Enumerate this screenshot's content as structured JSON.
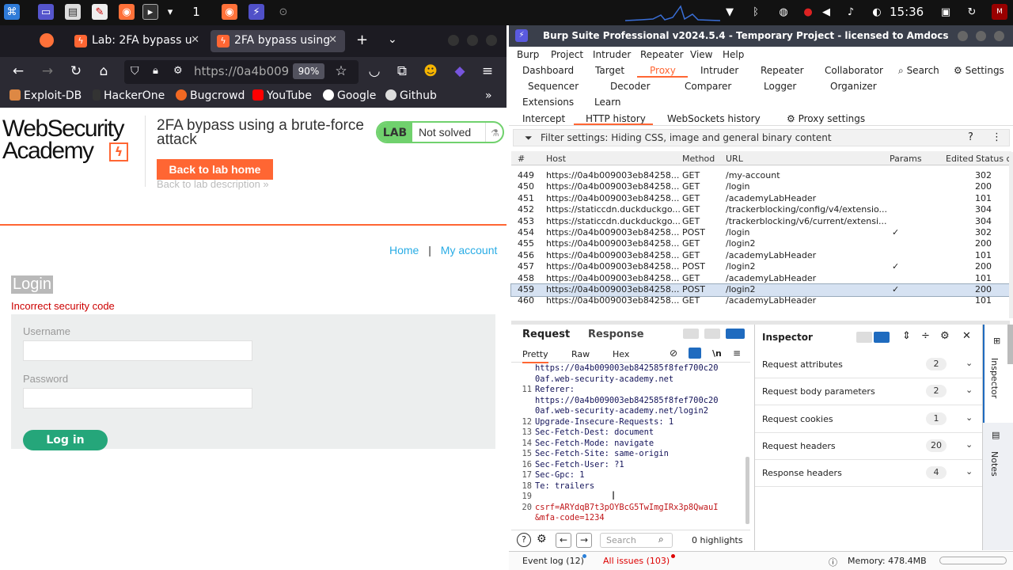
{
  "taskbar": {
    "workspace": "1",
    "clock": "15:36"
  },
  "firefox": {
    "tabs": [
      {
        "label": "Lab: 2FA bypass u"
      },
      {
        "label": "2FA bypass using"
      }
    ],
    "url": "https://0a4b009",
    "zoom": "90%",
    "bookmarks": [
      "Exploit-DB",
      "HackerOne",
      "Bugcrowd",
      "YouTube",
      "Google",
      "Github"
    ]
  },
  "page": {
    "logo_line1": "WebSecurity",
    "logo_line2": "Academy",
    "lab_title": "2FA bypass using a brute-force attack",
    "back_home": "Back to lab home",
    "back_desc": "Back to lab description",
    "badge_lab": "LAB",
    "badge_status": "Not solved",
    "nav_home": "Home",
    "nav_sep": "|",
    "nav_account": "My account",
    "login_heading": "Login",
    "error": "Incorrect security code",
    "username_label": "Username",
    "password_label": "Password",
    "login_button": "Log in"
  },
  "burp": {
    "title": "Burp Suite Professional v2024.5.4 - Temporary Project - licensed to Amdocs",
    "menu": [
      "Burp",
      "Project",
      "Intruder",
      "Repeater",
      "View",
      "Help"
    ],
    "tools_row1": [
      "Dashboard",
      "Target",
      "Proxy",
      "Intruder",
      "Repeater",
      "Collaborator"
    ],
    "tools_row2": [
      "Sequencer",
      "Decoder",
      "Comparer",
      "Logger",
      "Organizer"
    ],
    "tools_row3": [
      "Extensions",
      "Learn"
    ],
    "search": "Search",
    "settings": "Settings",
    "subtabs": [
      "Intercept",
      "HTTP history",
      "WebSockets history"
    ],
    "proxy_settings": "Proxy settings",
    "filter": "Filter settings: Hiding CSS, image and general binary content",
    "columns": [
      "#",
      "Host",
      "Method",
      "URL",
      "Params",
      "Edited",
      "Status c"
    ],
    "rows": [
      {
        "n": "449",
        "host": "https://0a4b009003eb84258...",
        "method": "GET",
        "url": "/my-account",
        "params": "",
        "status": "302"
      },
      {
        "n": "450",
        "host": "https://0a4b009003eb84258...",
        "method": "GET",
        "url": "/login",
        "params": "",
        "status": "200"
      },
      {
        "n": "451",
        "host": "https://0a4b009003eb84258...",
        "method": "GET",
        "url": "/academyLabHeader",
        "params": "",
        "status": "101"
      },
      {
        "n": "452",
        "host": "https://staticcdn.duckduckgo...",
        "method": "GET",
        "url": "/trackerblocking/config/v4/extensio...",
        "params": "",
        "status": "304"
      },
      {
        "n": "453",
        "host": "https://staticcdn.duckduckgo...",
        "method": "GET",
        "url": "/trackerblocking/v6/current/extensi...",
        "params": "",
        "status": "304"
      },
      {
        "n": "454",
        "host": "https://0a4b009003eb84258...",
        "method": "POST",
        "url": "/login",
        "params": "✓",
        "status": "302"
      },
      {
        "n": "455",
        "host": "https://0a4b009003eb84258...",
        "method": "GET",
        "url": "/login2",
        "params": "",
        "status": "200"
      },
      {
        "n": "456",
        "host": "https://0a4b009003eb84258...",
        "method": "GET",
        "url": "/academyLabHeader",
        "params": "",
        "status": "101"
      },
      {
        "n": "457",
        "host": "https://0a4b009003eb84258...",
        "method": "POST",
        "url": "/login2",
        "params": "✓",
        "status": "200"
      },
      {
        "n": "458",
        "host": "https://0a4b009003eb84258...",
        "method": "GET",
        "url": "/academyLabHeader",
        "params": "",
        "status": "101"
      },
      {
        "n": "459",
        "host": "https://0a4b009003eb84258...",
        "method": "POST",
        "url": "/login2",
        "params": "✓",
        "status": "200"
      },
      {
        "n": "460",
        "host": "https://0a4b009003eb84258...",
        "method": "GET",
        "url": "/academyLabHeader",
        "params": "",
        "status": "101"
      }
    ],
    "req_tab": "Request",
    "resp_tab": "Response",
    "view_tabs": [
      "Pretty",
      "Raw",
      "Hex"
    ],
    "newline_toggle": "\\n",
    "code_lines": [
      {
        "n": "",
        "t": "https://0a4b009003eb842585f8fef700c20",
        "cls": "k"
      },
      {
        "n": "",
        "t": "0af.web-security-academy.net",
        "cls": "k"
      },
      {
        "n": "11",
        "t": "Referer:",
        "cls": "k"
      },
      {
        "n": "",
        "t": "https://0a4b009003eb842585f8fef700c20",
        "cls": "k"
      },
      {
        "n": "",
        "t": "0af.web-security-academy.net/login2",
        "cls": "k"
      },
      {
        "n": "12",
        "t": "Upgrade-Insecure-Requests: 1",
        "cls": "k"
      },
      {
        "n": "13",
        "t": "Sec-Fetch-Dest: document",
        "cls": "k"
      },
      {
        "n": "14",
        "t": "Sec-Fetch-Mode: navigate",
        "cls": "k"
      },
      {
        "n": "15",
        "t": "Sec-Fetch-Site: same-origin",
        "cls": "k"
      },
      {
        "n": "16",
        "t": "Sec-Fetch-User: ?1",
        "cls": "k"
      },
      {
        "n": "17",
        "t": "Sec-Gpc: 1",
        "cls": "k"
      },
      {
        "n": "18",
        "t": "Te: trailers",
        "cls": "k"
      },
      {
        "n": "19",
        "t": "",
        "cls": "k"
      },
      {
        "n": "20",
        "t": "csrf=ARYdqB7t3pOYBcG5TwImgIRx3p8QwauI",
        "cls": "r"
      },
      {
        "n": "",
        "t": "&mfa-code=1234",
        "cls": "r"
      }
    ],
    "search_placeholder": "Search",
    "highlights": "0 highlights",
    "inspector_title": "Inspector",
    "inspector_rows": [
      {
        "label": "Request attributes",
        "count": "2"
      },
      {
        "label": "Request body parameters",
        "count": "2"
      },
      {
        "label": "Request cookies",
        "count": "1"
      },
      {
        "label": "Request headers",
        "count": "20"
      },
      {
        "label": "Response headers",
        "count": "4"
      }
    ],
    "rail_inspector": "Inspector",
    "rail_notes": "Notes",
    "event_log": "Event log (12)",
    "all_issues": "All issues (103)",
    "memory": "Memory: 478.4MB"
  },
  "colors": {
    "accent": "#ff6633",
    "green": "#25a67a",
    "burp_header": "#3a3f4b",
    "selected_row": "#d6e2f2"
  }
}
